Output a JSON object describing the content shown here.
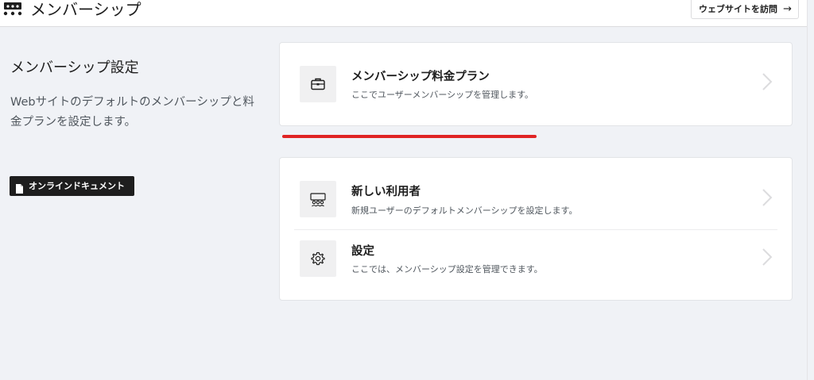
{
  "header": {
    "title": "メンバーシップ",
    "visit_label": "ウェブサイトを訪問",
    "visit_arrow": "→"
  },
  "sidebar": {
    "title": "メンバーシップ設定",
    "description": "Webサイトのデフォルトのメンバーシップと料金プランを設定します。",
    "docs_label": "オンラインドキュメント"
  },
  "cards": [
    {
      "items": [
        {
          "icon": "briefcase-icon",
          "title": "メンバーシップ料金プラン",
          "description": "ここでユーザーメンバーシップを管理します。"
        }
      ]
    },
    {
      "items": [
        {
          "icon": "users-icon",
          "title": "新しい利用者",
          "description": "新規ユーザーのデフォルトメンバーシップを設定します。"
        },
        {
          "icon": "gear-icon",
          "title": "設定",
          "description": "ここでは、メンバーシップ設定を管理できます。"
        }
      ]
    }
  ],
  "colors": {
    "annotation_underline": "#e02424",
    "background": "#f0f2f6",
    "dark_button": "#1e1e1e"
  }
}
